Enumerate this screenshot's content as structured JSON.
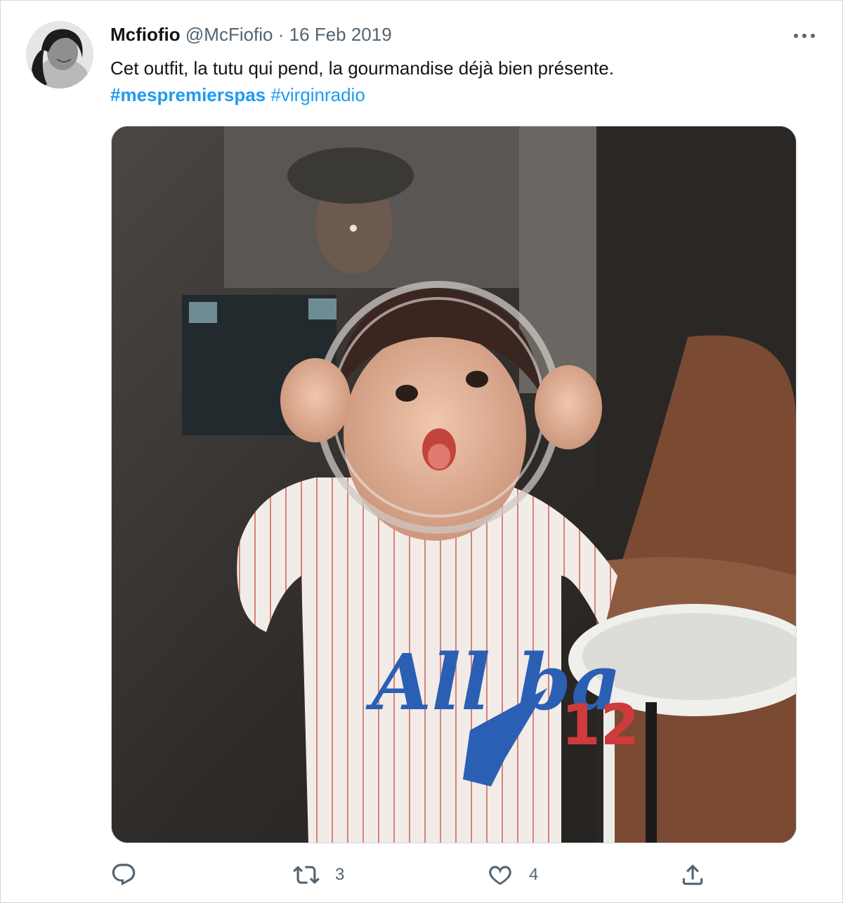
{
  "tweet": {
    "display_name": "Mcfiofio",
    "handle": "@McFiofio",
    "separator": "·",
    "date": "16 Feb 2019",
    "text": "Cet outfit, la tutu qui pend, la gourmandise déjà bien présente.",
    "hashtags": [
      "#mespremierspas",
      "#virginradio"
    ],
    "media_icon": "photo",
    "avatar_icon": "user-avatar"
  },
  "actions": {
    "reply": {
      "icon": "reply-icon",
      "count": ""
    },
    "retweet": {
      "icon": "retweet-icon",
      "count": "3"
    },
    "like": {
      "icon": "heart-icon",
      "count": "4"
    },
    "share": {
      "icon": "share-icon",
      "count": ""
    }
  },
  "colors": {
    "accent": "#1d9bf0",
    "secondary_text": "#536471",
    "border": "#cfd9de"
  }
}
